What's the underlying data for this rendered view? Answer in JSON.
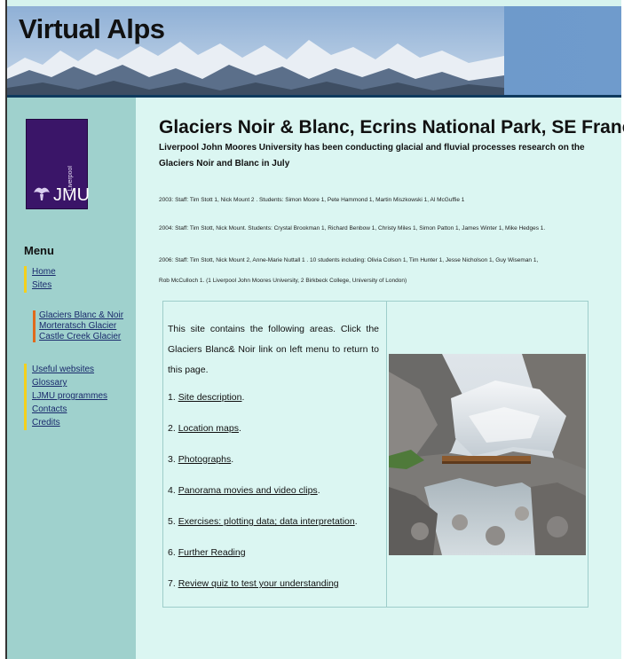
{
  "banner": {
    "title": "Virtual Alps"
  },
  "logo": {
    "small_text": "Liverpool",
    "big_text": "JMU"
  },
  "sidebar": {
    "menu_title": "Menu",
    "items_top": [
      {
        "label": "Home"
      },
      {
        "label": "Sites"
      }
    ],
    "sites": [
      {
        "label": "Glaciers Blanc & Noir"
      },
      {
        "label": "Morteratsch Glacier"
      },
      {
        "label": "Castle Creek Glacier"
      }
    ],
    "items_bottom": [
      {
        "label": "Useful websites"
      },
      {
        "label": "Glossary"
      },
      {
        "label": "LJMU programmes"
      },
      {
        "label": "Contacts"
      },
      {
        "label": "Credits"
      }
    ]
  },
  "main": {
    "heading": "Glaciers Noir & Blanc, Ecrins National Park, SE France",
    "intro": "Liverpool John Moores University has been conducting glacial and fluvial processes research on the Glaciers Noir and Blanc in July",
    "staff_2003": "2003: Staff: Tim Stott 1, Nick Mount 2 . Students: Simon Moore 1, Pete Hammond 1, Martin Miszkowski 1, Al McGuffie 1",
    "staff_2004": "2004: Staff: Tim Stott, Nick Mount. Students: Crystal Brookman 1, Richard Benbow 1, Christy Miles 1, Simon Patton 1, James Winter 1, Mike Hedges 1.",
    "staff_2006_line1": "2006: Staff: Tim Stott, Nick Mount 2, Anne-Marie Nuttall 1 . 10 students including: Olivia Colson 1, Tim Hunter 1, Jesse Nicholson 1, Guy Wiseman 1,",
    "staff_2006_line2": "Rob McCulloch 1. (1 Liverpool John Moores University, 2 Birkbeck College, University of London)",
    "box": {
      "lead": "This site contains the following areas. Click the Glaciers Blanc& Noir link on left menu to return to this page.",
      "items": [
        {
          "num": "1.",
          "label": "Site description",
          "suffix": "."
        },
        {
          "num": "2.",
          "label": "Location maps",
          "suffix": "."
        },
        {
          "num": "3.",
          "label": "Photographs",
          "suffix": "."
        },
        {
          "num": "4.",
          "label": "Panorama movies and video clips",
          "suffix": "."
        },
        {
          "num": "5.",
          "label": "Exercises: plotting data; data interpretation",
          "suffix": "."
        },
        {
          "num": "6.",
          "label": "Further Reading",
          "suffix": ""
        },
        {
          "num": "7.",
          "label": "Review quiz to test your understanding",
          "suffix": ""
        }
      ]
    }
  }
}
